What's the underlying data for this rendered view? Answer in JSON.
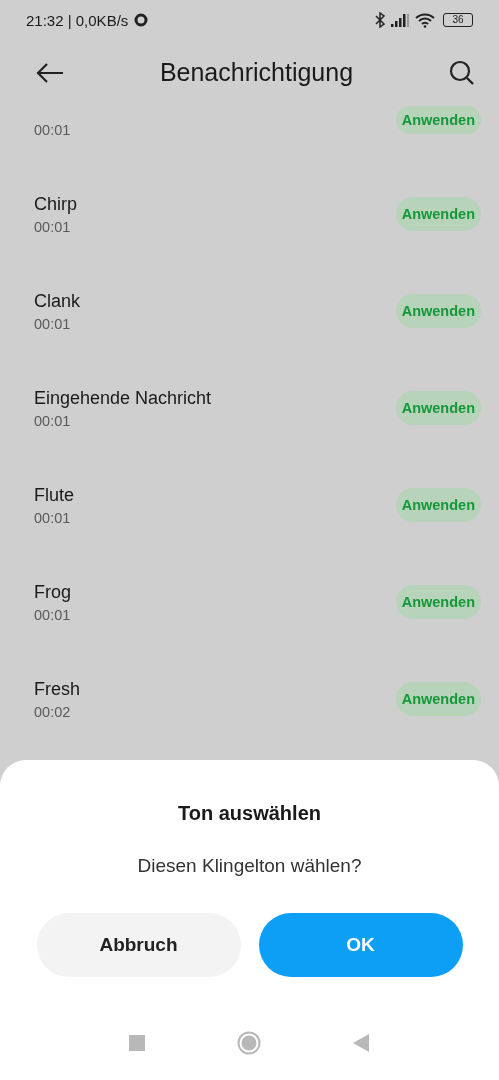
{
  "status_bar": {
    "time": "21:32 | 0,0KB/s",
    "battery": "36"
  },
  "header": {
    "title": "Benachrichtigung"
  },
  "sounds": [
    {
      "duration": "00:01",
      "action": "Anwenden"
    },
    {
      "name": "Chirp",
      "duration": "00:01",
      "action": "Anwenden"
    },
    {
      "name": "Clank",
      "duration": "00:01",
      "action": "Anwenden"
    },
    {
      "name": "Eingehende Nachricht",
      "duration": "00:01",
      "action": "Anwenden"
    },
    {
      "name": "Flute",
      "duration": "00:01",
      "action": "Anwenden"
    },
    {
      "name": "Frog",
      "duration": "00:01",
      "action": "Anwenden"
    },
    {
      "name": "Fresh",
      "duration": "00:02",
      "action": "Anwenden"
    }
  ],
  "dialog": {
    "title": "Ton auswählen",
    "message": "Diesen Klingelton wählen?",
    "buttons": [
      {
        "label": "Abbruch",
        "kind": "cancel"
      },
      {
        "label": "OK",
        "kind": "confirm"
      }
    ]
  }
}
